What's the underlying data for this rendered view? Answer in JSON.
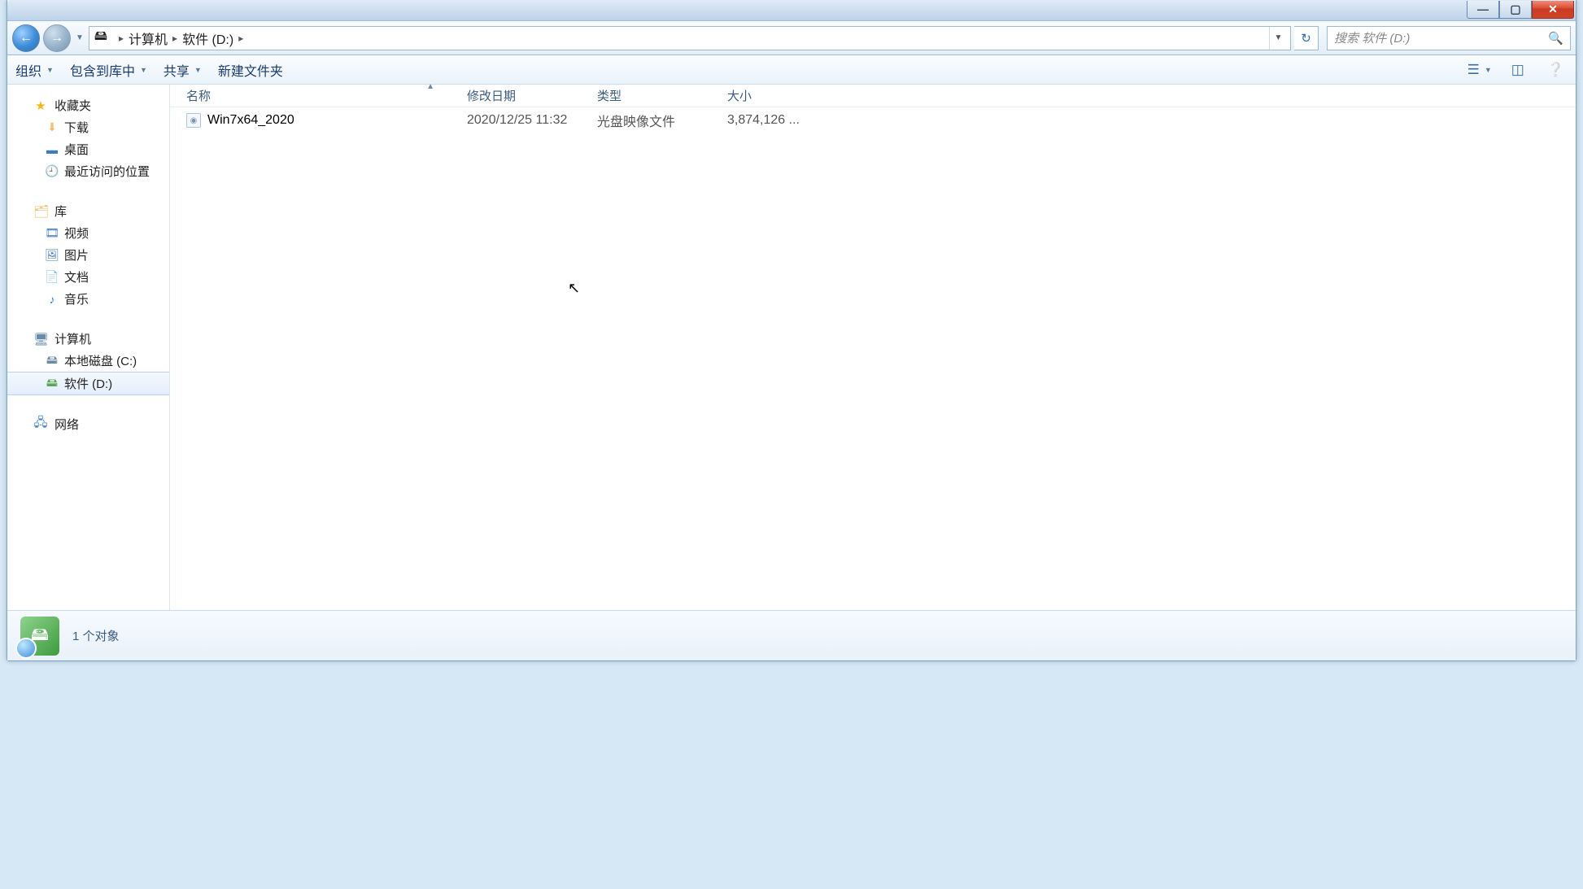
{
  "window": {
    "title": ""
  },
  "address": {
    "crumbs": [
      "计算机",
      "软件 (D:)"
    ]
  },
  "search": {
    "placeholder": "搜索 软件 (D:)"
  },
  "toolbar": {
    "organize": "组织",
    "include_in_library": "包含到库中",
    "share": "共享",
    "new_folder": "新建文件夹"
  },
  "sidebar": {
    "favorites": {
      "label": "收藏夹",
      "items": [
        {
          "label": "下载"
        },
        {
          "label": "桌面"
        },
        {
          "label": "最近访问的位置"
        }
      ]
    },
    "libraries": {
      "label": "库",
      "items": [
        {
          "label": "视频"
        },
        {
          "label": "图片"
        },
        {
          "label": "文档"
        },
        {
          "label": "音乐"
        }
      ]
    },
    "computer": {
      "label": "计算机",
      "items": [
        {
          "label": "本地磁盘 (C:)"
        },
        {
          "label": "软件 (D:)",
          "selected": true
        }
      ]
    },
    "network": {
      "label": "网络"
    }
  },
  "columns": {
    "name": "名称",
    "date": "修改日期",
    "type": "类型",
    "size": "大小"
  },
  "files": [
    {
      "name": "Win7x64_2020",
      "date": "2020/12/25 11:32",
      "type": "光盘映像文件",
      "size": "3,874,126 ..."
    }
  ],
  "status": {
    "text": "1 个对象"
  }
}
